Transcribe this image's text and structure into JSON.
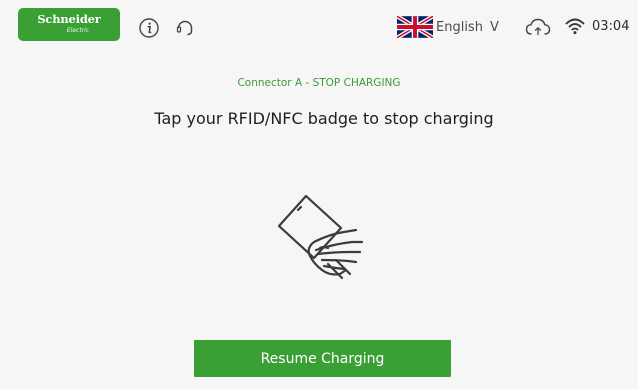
{
  "header": {
    "logo": {
      "brand": "Schneider",
      "sub": "Electric"
    },
    "language": {
      "selected": "English",
      "chevron": "V"
    },
    "clock": "03:04",
    "icons": {
      "info": "info-icon",
      "help": "headset-icon",
      "cloud": "cloud-sync-icon",
      "wifi": "wifi-icon",
      "flag": "uk-flag-icon"
    }
  },
  "main": {
    "connector_title": "Connector A - STOP CHARGING",
    "instruction": "Tap your RFID/NFC badge to stop charging",
    "illustration": "hand-badge-icon",
    "resume_label": "Resume Charging"
  },
  "colors": {
    "brand_green": "#3aa035",
    "title_green": "#3d9a3a",
    "background": "#f6f6f6"
  }
}
